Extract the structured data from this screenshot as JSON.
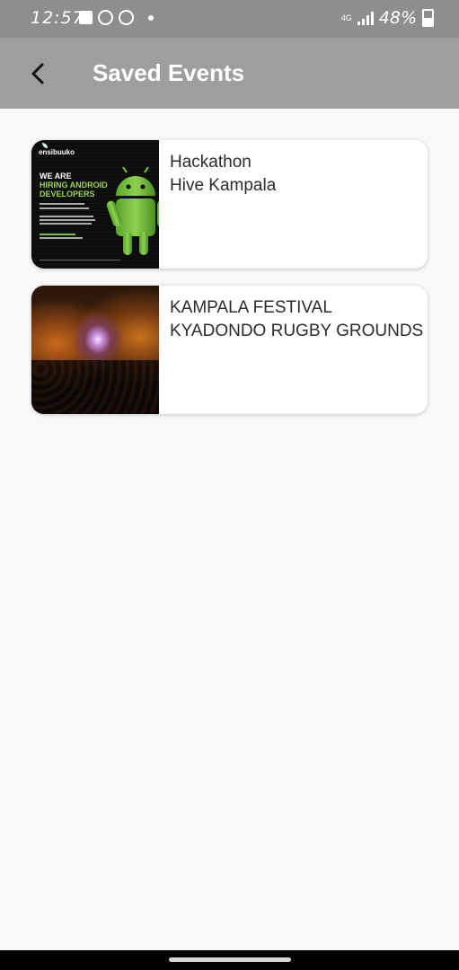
{
  "status_bar": {
    "time": "12:57",
    "network": "4G",
    "battery": "48%"
  },
  "header": {
    "title": "Saved Events"
  },
  "events": [
    {
      "title": "Hackathon",
      "venue": "Hive Kampala",
      "poster": {
        "brand": "ensibuuko",
        "line1": "WE ARE",
        "line2": "HIRING ANDROID DEVELOPERS",
        "icon": "android-robot-icon"
      }
    },
    {
      "title": "KAMPALA FESTIVAL",
      "venue": "KYADONDO RUGBY GROUNDS"
    }
  ],
  "colors": {
    "status_bar": "#8e8e8e",
    "app_bar": "#9e9e9e",
    "background": "#f8f8f8",
    "android_green": "#7cc242"
  }
}
